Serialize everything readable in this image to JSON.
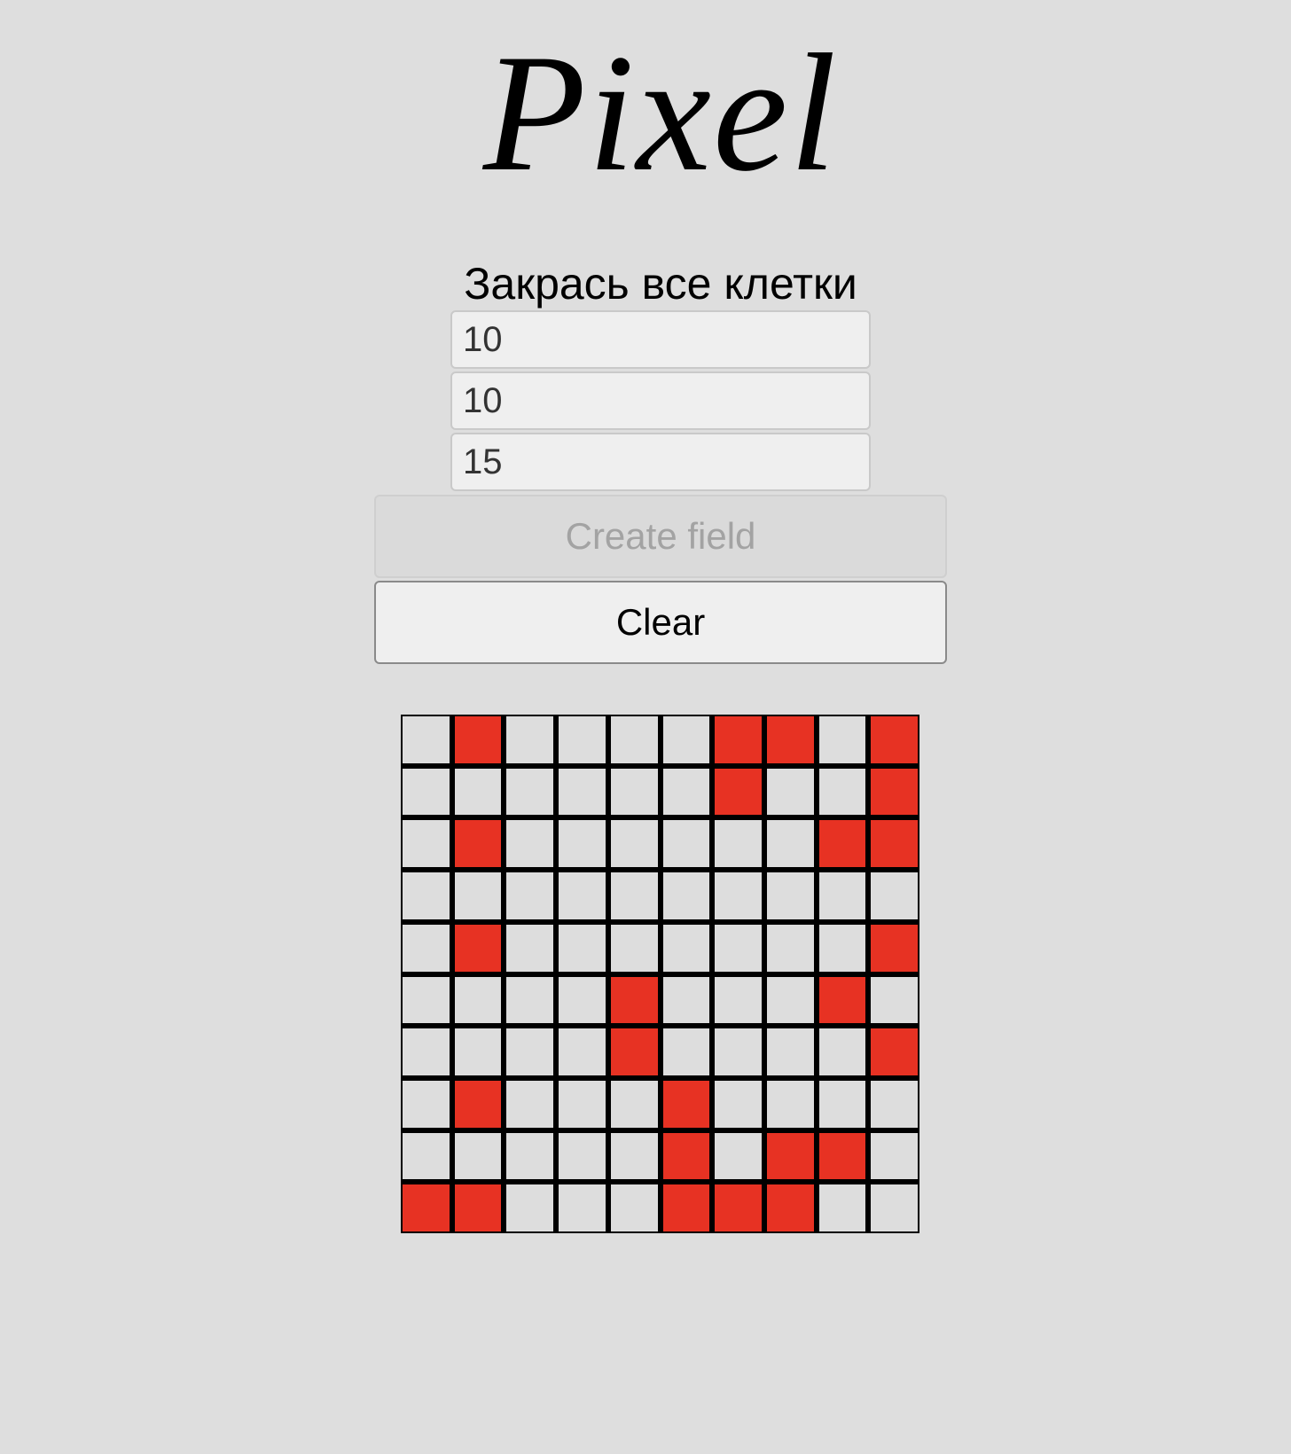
{
  "title": "Pixel",
  "subtitle": "Закрась все клетки",
  "inputs": {
    "width_value": "10",
    "height_value": "10",
    "count_value": "15"
  },
  "buttons": {
    "create_label": "Create field",
    "clear_label": "Clear"
  },
  "colors": {
    "background": "#dedede",
    "filled": "#e73223",
    "empty": "#dddddd",
    "grid_line": "#000000"
  },
  "grid": {
    "rows": 10,
    "cols": 10,
    "cells": [
      [
        0,
        1,
        0,
        0,
        0,
        0,
        1,
        1,
        0,
        1
      ],
      [
        0,
        0,
        0,
        0,
        0,
        0,
        1,
        0,
        0,
        1
      ],
      [
        0,
        1,
        0,
        0,
        0,
        0,
        0,
        0,
        1,
        1
      ],
      [
        0,
        0,
        0,
        0,
        0,
        0,
        0,
        0,
        0,
        0
      ],
      [
        0,
        1,
        0,
        0,
        0,
        0,
        0,
        0,
        0,
        1
      ],
      [
        0,
        0,
        0,
        0,
        1,
        0,
        0,
        0,
        1,
        0
      ],
      [
        0,
        0,
        0,
        0,
        1,
        0,
        0,
        0,
        0,
        1
      ],
      [
        0,
        1,
        0,
        0,
        0,
        1,
        0,
        0,
        0,
        0
      ],
      [
        0,
        0,
        0,
        0,
        0,
        1,
        0,
        1,
        1,
        0
      ],
      [
        1,
        1,
        0,
        0,
        0,
        1,
        1,
        1,
        0,
        0
      ]
    ]
  }
}
